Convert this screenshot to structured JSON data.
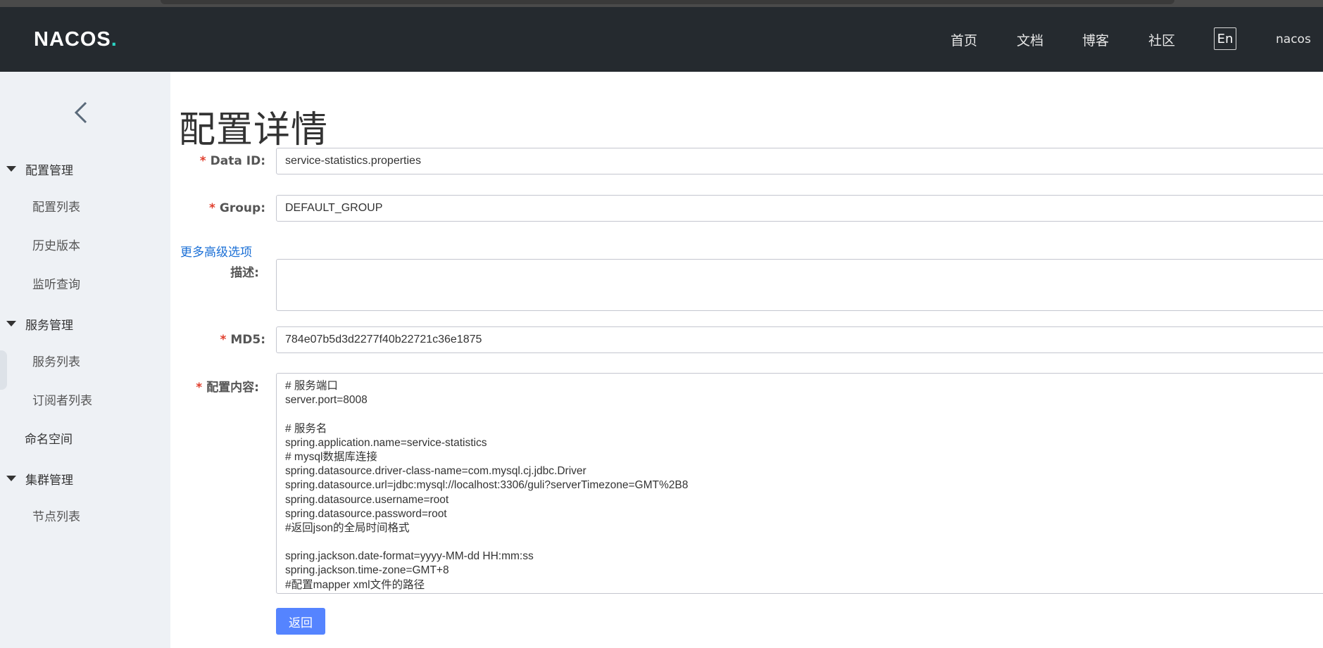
{
  "app": {
    "logo_text": "NACOS",
    "logo_dot": "."
  },
  "header": {
    "nav": [
      "首页",
      "文档",
      "博客",
      "社区"
    ],
    "lang_button": "En",
    "user": "nacos"
  },
  "sidebar": {
    "groups": [
      {
        "label": "配置管理",
        "items": [
          "配置列表",
          "历史版本",
          "监听查询"
        ]
      },
      {
        "label": "服务管理",
        "items": [
          "服务列表",
          "订阅者列表"
        ]
      },
      {
        "label": "命名空间"
      },
      {
        "label": "集群管理",
        "items": [
          "节点列表"
        ]
      }
    ]
  },
  "page": {
    "title": "配置详情",
    "required_mark": "*",
    "fields": {
      "data_id": {
        "label": "Data ID:",
        "value": "service-statistics.properties"
      },
      "group": {
        "label": "Group:",
        "value": "DEFAULT_GROUP"
      },
      "more_options": "更多高级选项",
      "description": {
        "label": "描述:",
        "value": ""
      },
      "md5": {
        "label": "MD5:",
        "value": "784e07b5d3d2277f40b22721c36e1875"
      },
      "content": {
        "label": "配置内容:",
        "lines": [
          "# 服务端口",
          "server.port=8008",
          "",
          "# 服务名",
          "spring.application.name=service-statistics",
          "# mysql数据库连接",
          "spring.datasource.driver-class-name=com.mysql.cj.jdbc.Driver",
          "spring.datasource.url=jdbc:mysql://localhost:3306/guli?serverTimezone=GMT%2B8",
          "spring.datasource.username=root",
          "spring.datasource.password=root",
          "#返回json的全局时间格式",
          "",
          "spring.jackson.date-format=yyyy-MM-dd HH:mm:ss",
          "spring.jackson.time-zone=GMT+8",
          "#配置mapper xml文件的路径"
        ]
      }
    },
    "back_button": "返回"
  },
  "colors": {
    "topbar_bg": "#252a2f",
    "sidebar_bg": "#eef1f5",
    "primary_button": "#5584ff",
    "link": "#1a6fd6",
    "required": "#e03e2d"
  }
}
